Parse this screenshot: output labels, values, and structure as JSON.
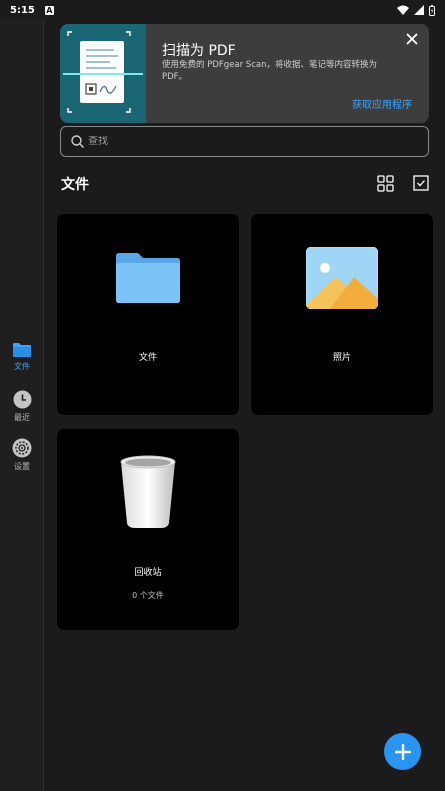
{
  "status_bar": {
    "time": "5:15",
    "notification_badge": "A"
  },
  "sidebar": {
    "items": [
      {
        "label": "文件",
        "icon": "folder-icon",
        "active": true
      },
      {
        "label": "最近",
        "icon": "clock-icon",
        "active": false
      },
      {
        "label": "设置",
        "icon": "gear-icon",
        "active": false
      }
    ]
  },
  "banner": {
    "title": "扫描为 PDF",
    "description": "使用免费的 PDFgear Scan，将收据、笔记等内容转换为 PDF。",
    "cta": "获取应用程序"
  },
  "search": {
    "placeholder": "查找"
  },
  "section": {
    "title": "文件"
  },
  "cards": [
    {
      "label": "文件",
      "icon": "folder-icon"
    },
    {
      "label": "照片",
      "icon": "photo-icon"
    },
    {
      "label": "回收站",
      "icon": "trash-icon",
      "sublabel": "0 个文件"
    }
  ],
  "colors": {
    "accent": "#3ea3ff",
    "fab": "#2a95f0",
    "background": "#1b1b1b",
    "card": "#000000",
    "banner": "#3d3d3d"
  }
}
